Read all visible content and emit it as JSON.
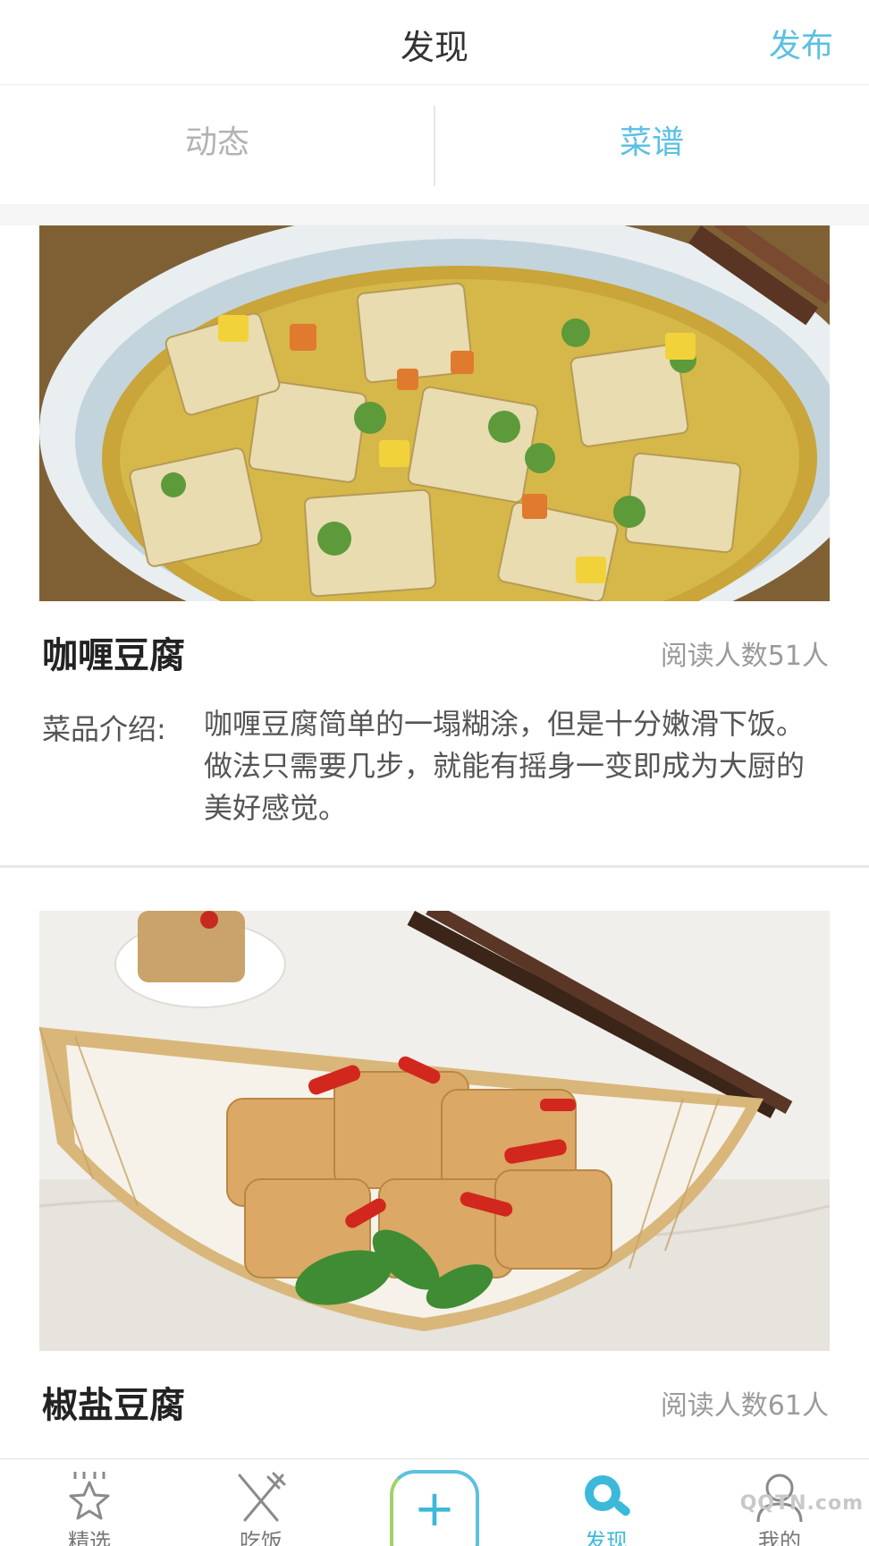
{
  "header": {
    "title": "发现",
    "publish_label": "发布"
  },
  "tabs": [
    {
      "label": "动态",
      "active": false
    },
    {
      "label": "菜谱",
      "active": true
    }
  ],
  "recipes": [
    {
      "title": "咖喱豆腐",
      "read_count": "阅读人数51人",
      "intro_label": "菜品介绍:",
      "intro_text": "咖喱豆腐简单的一塌糊涂，但是十分嫩滑下饭。做法只需要几步，就能有摇身一变即成为大厨的美好感觉。"
    },
    {
      "title": "椒盐豆腐",
      "read_count": "阅读人数61人"
    }
  ],
  "bottom_nav": [
    {
      "label": "精选",
      "icon": "star-icon",
      "active": false
    },
    {
      "label": "吃饭",
      "icon": "fork-knife-icon",
      "active": false
    },
    {
      "label": "+",
      "icon": "plus-icon",
      "active": false
    },
    {
      "label": "发现",
      "icon": "search-icon",
      "active": true
    },
    {
      "label": "我的",
      "icon": "person-icon",
      "active": false
    }
  ],
  "watermark": "QQTN.com",
  "colors": {
    "accent": "#5bc0e1",
    "active_nav": "#3cb9d9",
    "divider": "#e8e8e8"
  }
}
